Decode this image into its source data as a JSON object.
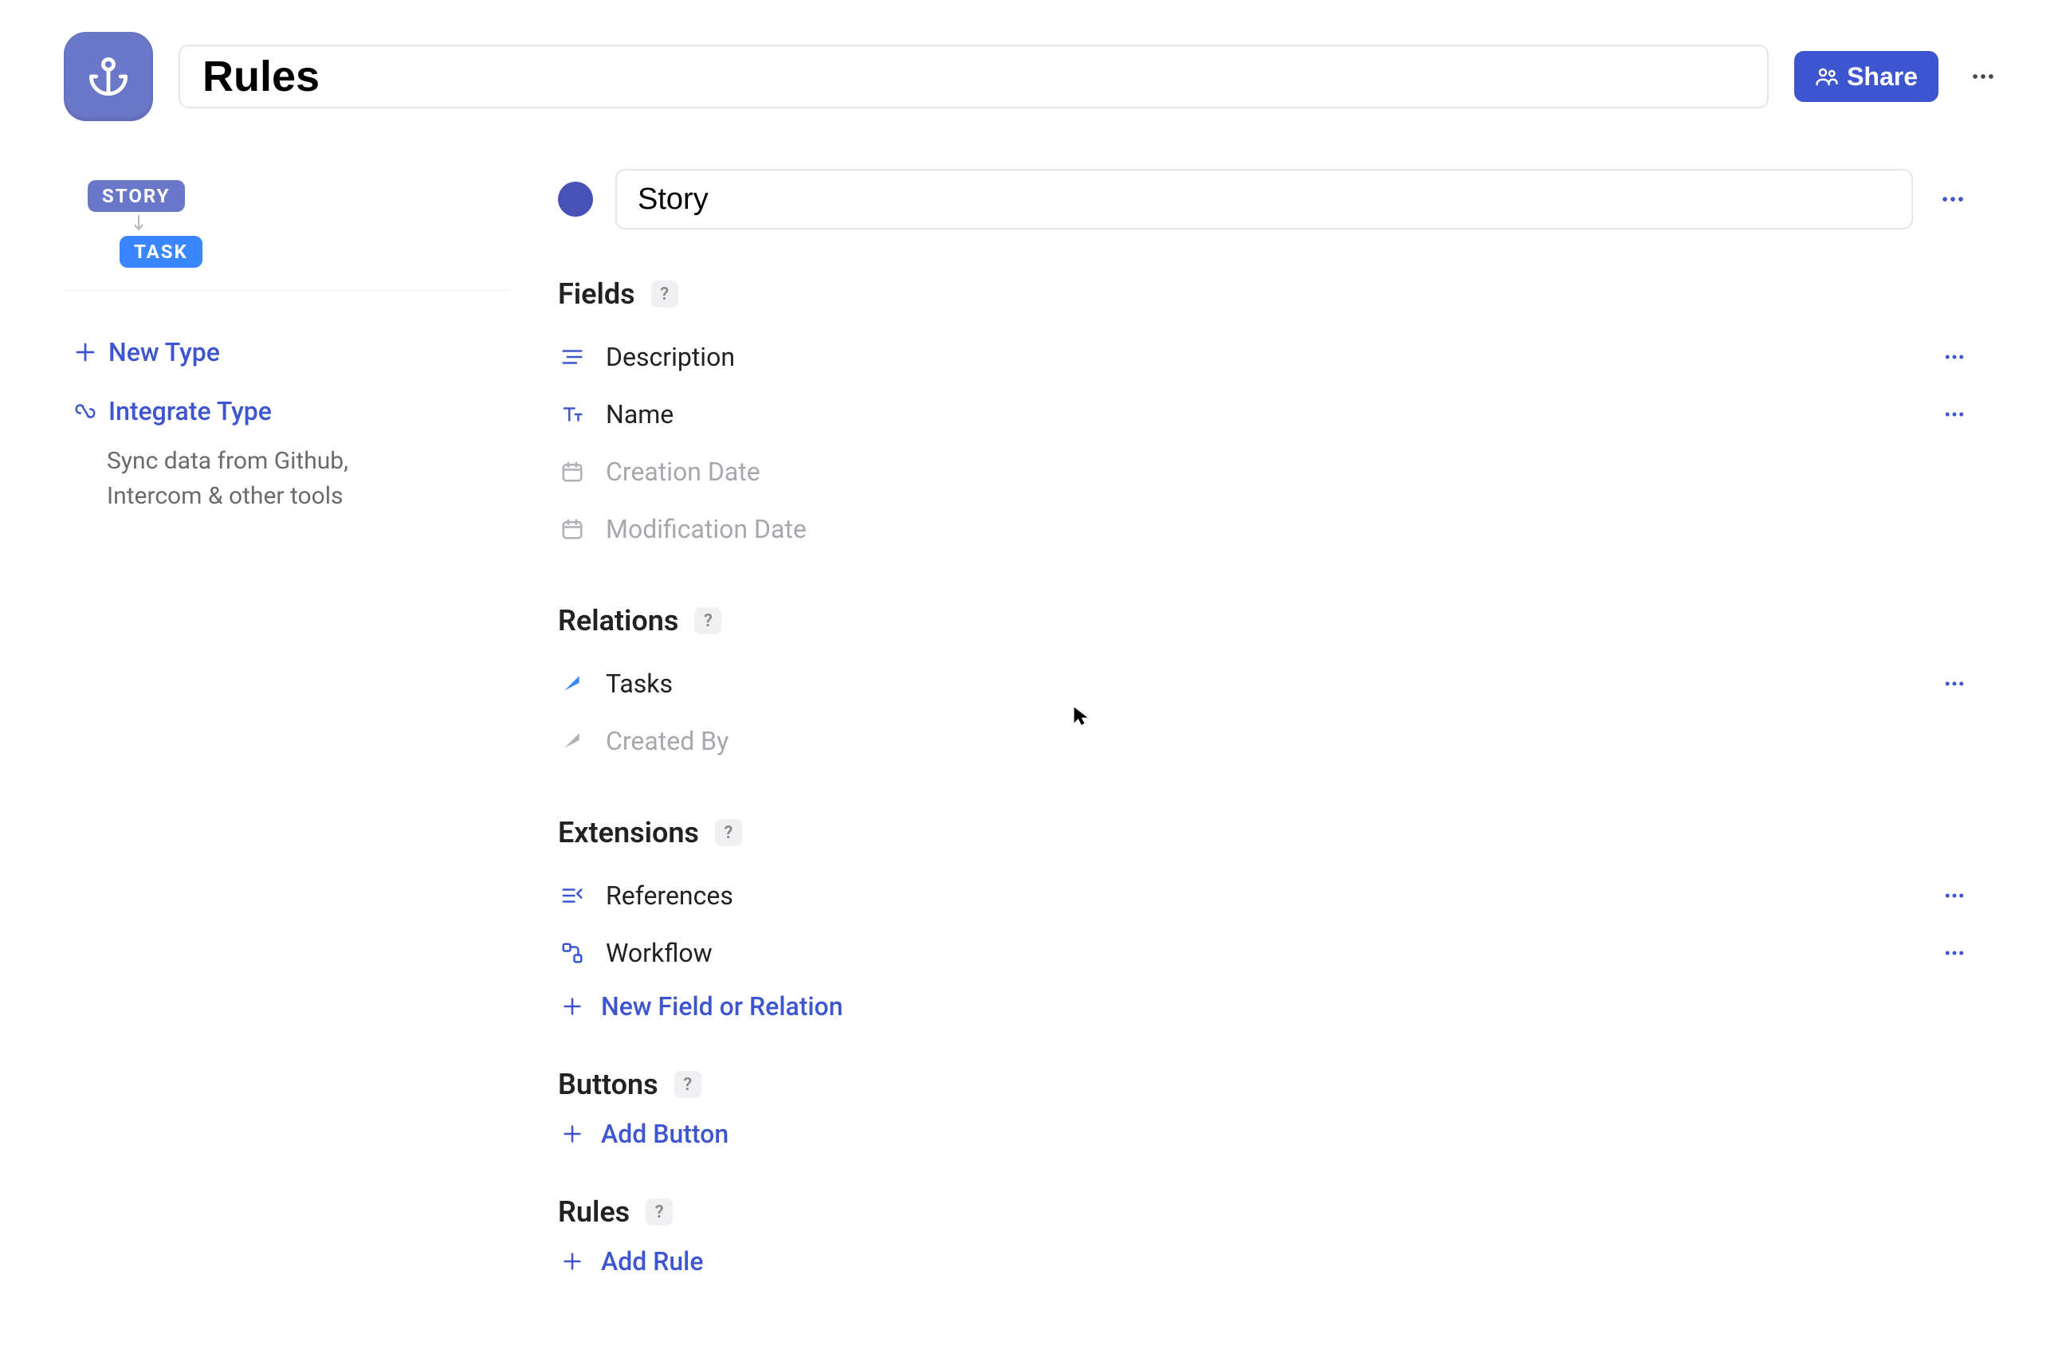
{
  "header": {
    "title": "Rules",
    "share_label": "Share"
  },
  "sidebar": {
    "type_tree": {
      "parent": "STORY",
      "child": "TASK"
    },
    "new_type_label": "New Type",
    "integrate_type_label": "Integrate Type",
    "integrate_desc": "Sync data from Github, Intercom & other tools"
  },
  "entity": {
    "title": "Story"
  },
  "sections": {
    "fields": {
      "title": "Fields",
      "items": [
        {
          "label": "Description",
          "muted": false,
          "icon": "text-block-icon",
          "has_more": true
        },
        {
          "label": "Name",
          "muted": false,
          "icon": "text-small-icon",
          "has_more": true
        },
        {
          "label": "Creation Date",
          "muted": true,
          "icon": "calendar-icon",
          "has_more": false
        },
        {
          "label": "Modification Date",
          "muted": true,
          "icon": "calendar-icon",
          "has_more": false
        }
      ]
    },
    "relations": {
      "title": "Relations",
      "items": [
        {
          "label": "Tasks",
          "muted": false,
          "icon": "relation-icon",
          "has_more": true
        },
        {
          "label": "Created By",
          "muted": true,
          "icon": "relation-muted-icon",
          "has_more": false
        }
      ]
    },
    "extensions": {
      "title": "Extensions",
      "items": [
        {
          "label": "References",
          "muted": false,
          "icon": "references-icon",
          "has_more": true
        },
        {
          "label": "Workflow",
          "muted": false,
          "icon": "workflow-icon",
          "has_more": true
        }
      ],
      "add_label": "New Field or Relation"
    },
    "buttons": {
      "title": "Buttons",
      "add_label": "Add Button"
    },
    "rules": {
      "title": "Rules",
      "add_label": "Add Rule"
    }
  }
}
